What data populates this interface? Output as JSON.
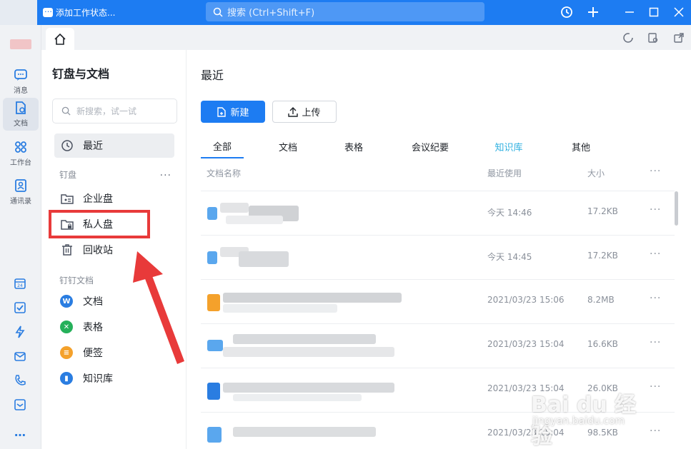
{
  "titlebar": {
    "status_label": "添加工作状态...",
    "search_placeholder": "搜索 (Ctrl+Shift+F)"
  },
  "rail": {
    "items": [
      {
        "label": "消息"
      },
      {
        "label": "文档"
      },
      {
        "label": "工作台"
      },
      {
        "label": "通讯录"
      }
    ],
    "more": "…"
  },
  "sidebar": {
    "title": "钉盘与文档",
    "search_placeholder": "新搜索，试一试",
    "recent": "最近",
    "section_drive": "钉盘",
    "section_more": "···",
    "drive_items": [
      {
        "label": "企业盘"
      },
      {
        "label": "私人盘"
      },
      {
        "label": "回收站"
      }
    ],
    "section_docs": "钉钉文档",
    "doc_items": [
      {
        "label": "文档",
        "color": "#2a7de1"
      },
      {
        "label": "表格",
        "color": "#25b05a"
      },
      {
        "label": "便签",
        "color": "#f4a12b"
      },
      {
        "label": "知识库",
        "color": "#2a7de1"
      }
    ]
  },
  "main": {
    "title": "最近",
    "new_button": "新建",
    "upload_button": "上传",
    "tabs": [
      {
        "label": "全部"
      },
      {
        "label": "文档"
      },
      {
        "label": "表格"
      },
      {
        "label": "会议纪要"
      },
      {
        "label": "知识库"
      },
      {
        "label": "其他"
      }
    ],
    "columns": {
      "name": "文档名称",
      "date": "最近使用",
      "size": "大小",
      "more": "···"
    },
    "rows": [
      {
        "date": "今天 14:46",
        "size": "17.2KB",
        "more": "···"
      },
      {
        "date": "今天 14:45",
        "size": "17.2KB",
        "more": "···"
      },
      {
        "date": "2021/03/23 15:06",
        "size": "8.2MB",
        "more": "···"
      },
      {
        "date": "2021/03/23 15:04",
        "size": "16.6KB",
        "more": "···"
      },
      {
        "date": "2021/03/23 15:04",
        "size": "26.0KB",
        "more": "···"
      },
      {
        "date": "2021/03/23 15:04",
        "size": "98.5KB",
        "more": "···"
      }
    ]
  },
  "watermark": {
    "brand": "Bai du 经验",
    "url": "jingyan.baidu.com"
  },
  "colors": {
    "accent": "#1d7cf2",
    "annotation_red": "#e83a3a"
  }
}
